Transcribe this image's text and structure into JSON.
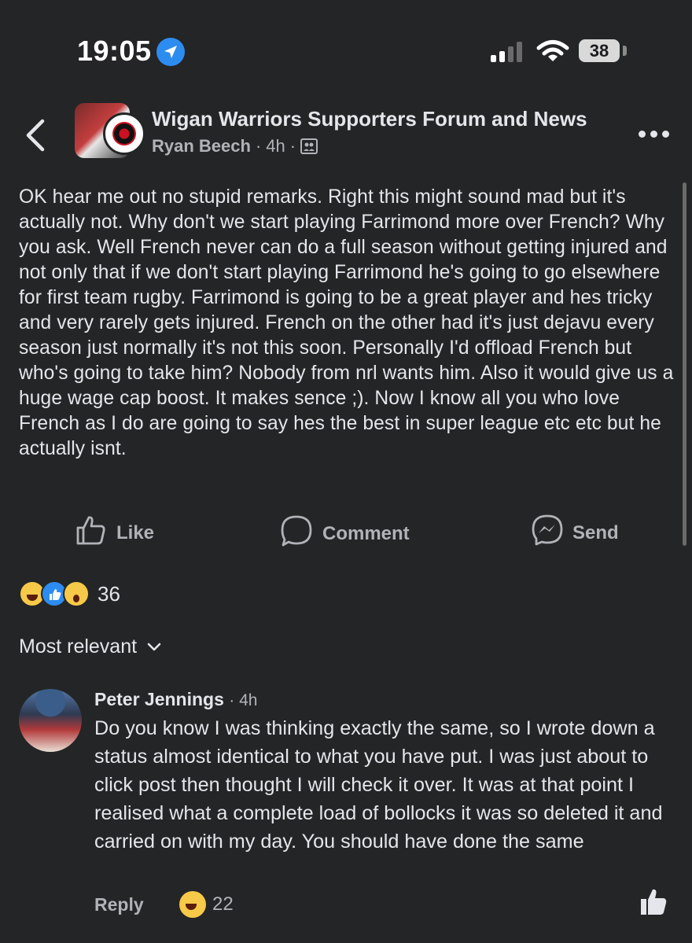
{
  "status_bar": {
    "time": "19:05",
    "battery": "38"
  },
  "header": {
    "group_name": "Wigan Warriors Supporters Forum and News",
    "author": "Ryan Beech",
    "sep1": "·",
    "time": "4h",
    "sep2": "·"
  },
  "post": {
    "text": "OK hear me out no stupid remarks. Right this might sound mad but it's actually not. Why don't we start playing Farrimond more over French? Why you ask. Well French never can do a full season without getting injured and not only that if we don't start playing Farrimond he's going to go elsewhere for first team rugby. Farrimond is going to be a great player and hes tricky and very rarely gets injured. French on the other had it's just dejavu every season just normally it's not this soon. Personally I'd offload French but who's going to take him? Nobody from nrl wants him. Also it would give us a huge wage cap boost. It makes sence ;). Now I know all you who love French as I do are going to say hes the best in super league etc etc but he actually isnt."
  },
  "actions": {
    "like": "Like",
    "comment": "Comment",
    "send": "Send"
  },
  "reactions": {
    "count": "36"
  },
  "sort": {
    "label": "Most relevant"
  },
  "comment": {
    "name": "Peter Jennings",
    "time": "· 4h",
    "text": "Do you know I was thinking exactly the same, so I wrote down a status almost identical to what you have put. I was just about to click post then thought I will check it over. It was at that point I realised what a complete load of bollocks it was so deleted it and carried on with my day. You should have done the same",
    "reply": "Reply",
    "reaction_count": "22"
  },
  "colors": {
    "background": "#242526",
    "text": "#e4e6eb",
    "secondary": "#b0b3b8",
    "accent": "#2d8cf0"
  }
}
